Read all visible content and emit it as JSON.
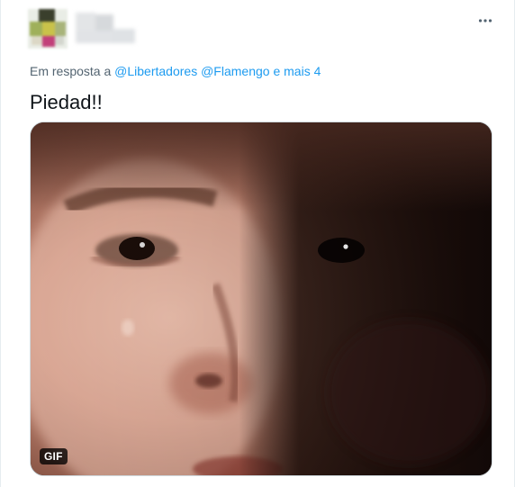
{
  "tweet": {
    "reply_prefix": "Em resposta a",
    "mentions": [
      "@Libertadores",
      "@Flamengo"
    ],
    "reply_suffix": "e mais 4",
    "text": "Piedad!!",
    "more_icon": "more-horizontal-icon",
    "media": {
      "type": "gif",
      "badge": "GIF"
    }
  },
  "colors": {
    "text": "#0f1419",
    "secondary": "#536471",
    "link": "#1d9bf0",
    "border": "#cfd9de"
  }
}
